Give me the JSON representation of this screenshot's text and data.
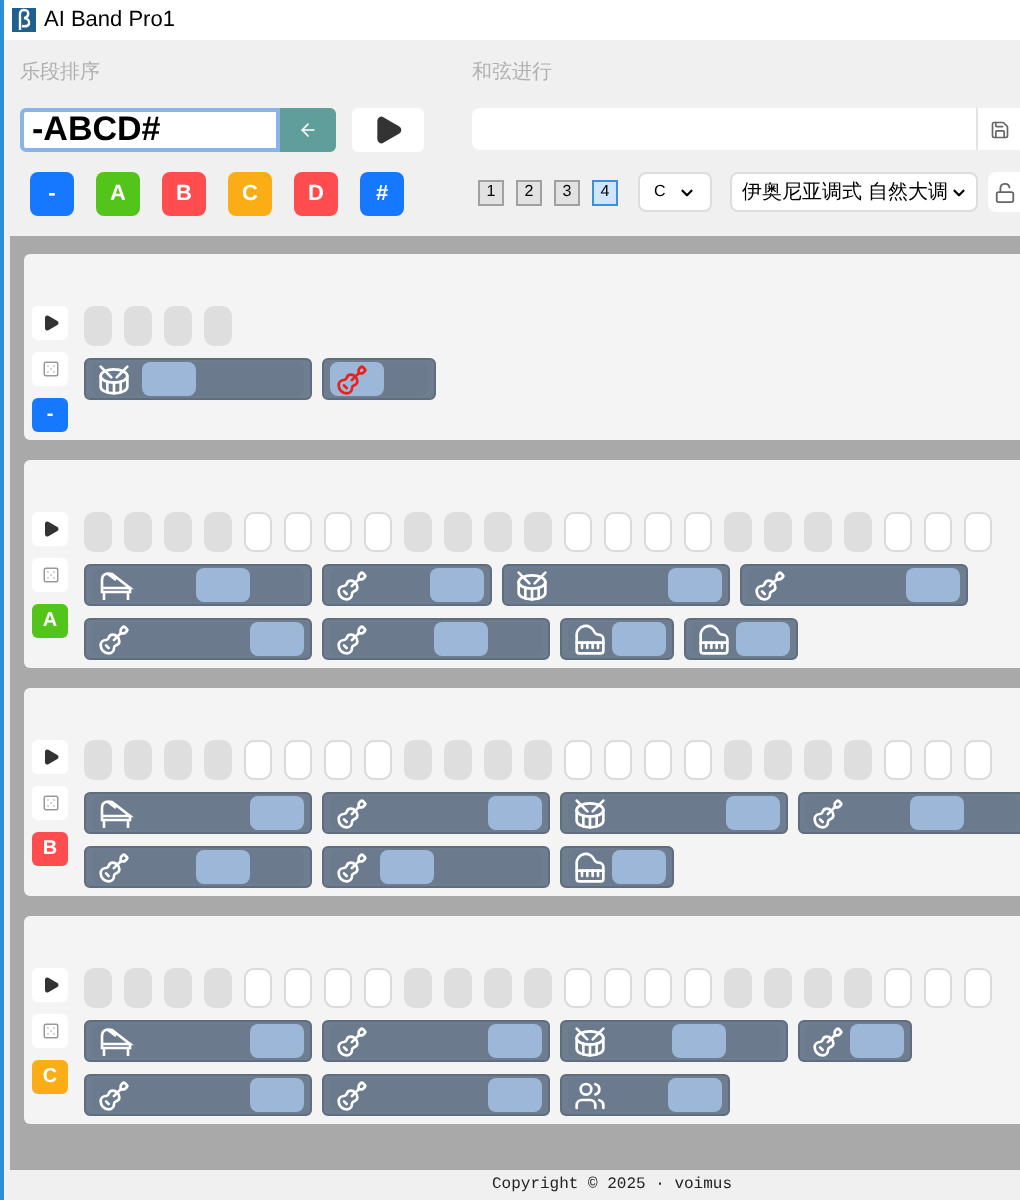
{
  "window": {
    "title": "AI Band Pro1"
  },
  "arrangement": {
    "label": "乐段排序",
    "value": "-ABCD#"
  },
  "progression": {
    "label": "和弦进行"
  },
  "section_buttons": [
    {
      "label": "-",
      "color": "#1677ff"
    },
    {
      "label": "A",
      "color": "#52c41a"
    },
    {
      "label": "B",
      "color": "#ff4d4f"
    },
    {
      "label": "C",
      "color": "#faad14"
    },
    {
      "label": "D",
      "color": "#ff4d4f"
    },
    {
      "label": "#",
      "color": "#1677ff"
    }
  ],
  "pages": [
    {
      "label": "1",
      "selected": false
    },
    {
      "label": "2",
      "selected": false
    },
    {
      "label": "3",
      "selected": false
    },
    {
      "label": "4",
      "selected": true
    }
  ],
  "key_select": {
    "value": "C"
  },
  "mode_select": {
    "value": "伊奥尼亚调式 自然大调"
  },
  "sections": [
    {
      "badge": "-",
      "color": "#1677ff",
      "beats": [
        true,
        true,
        true,
        true
      ],
      "rows": [
        [
          {
            "kind": "long",
            "icon": {
              "kind": "drum"
            },
            "selected": false,
            "level": 0.32
          },
          {
            "kind": "short",
            "icon": {
              "kind": "electric-guitar"
            },
            "selected": true,
            "level": 0
          }
        ]
      ]
    },
    {
      "badge": "A",
      "color": "#52c41a",
      "beats": [
        true,
        true,
        true,
        true,
        false,
        false,
        false,
        false,
        true,
        true,
        true,
        true,
        false,
        false,
        false,
        false,
        true,
        true,
        true,
        true,
        false,
        false,
        false
      ],
      "rows": [
        [
          {
            "kind": "long",
            "icon": {
              "kind": "piano"
            },
            "selected": false,
            "level": 0.66
          },
          {
            "kind": "medium",
            "icon": {
              "kind": "electric-guitar"
            },
            "selected": false,
            "level": 1
          },
          {
            "kind": "long",
            "icon": {
              "kind": "drum"
            },
            "selected": false,
            "level": 1
          },
          {
            "kind": "long",
            "icon": {
              "kind": "acoustic-guitar"
            },
            "selected": false,
            "level": 1
          }
        ],
        [
          {
            "kind": "long",
            "icon": {
              "kind": "electric-guitar"
            },
            "selected": false,
            "level": 1
          },
          {
            "kind": "long",
            "icon": {
              "kind": "bass"
            },
            "selected": false,
            "level": 0.66
          },
          {
            "kind": "short",
            "icon": {
              "kind": "keyboard"
            },
            "selected": false,
            "level": 1
          },
          {
            "kind": "short",
            "icon": {
              "kind": "keyboard"
            },
            "selected": false,
            "level": 1
          }
        ]
      ]
    },
    {
      "badge": "B",
      "color": "#ff4d4f",
      "beats": [
        true,
        true,
        true,
        true,
        false,
        false,
        false,
        false,
        true,
        true,
        true,
        true,
        false,
        false,
        false,
        false,
        true,
        true,
        true,
        true,
        false,
        false,
        false
      ],
      "rows": [
        [
          {
            "kind": "long",
            "icon": {
              "kind": "piano"
            },
            "selected": false,
            "level": 1
          },
          {
            "kind": "long",
            "icon": {
              "kind": "electric-guitar"
            },
            "selected": false,
            "level": 1
          },
          {
            "kind": "long",
            "icon": {
              "kind": "drum"
            },
            "selected": false,
            "level": 1
          },
          {
            "kind": "long",
            "icon": {
              "kind": "acoustic-guitar"
            },
            "selected": false,
            "level": 0.66
          }
        ],
        [
          {
            "kind": "long",
            "icon": {
              "kind": "electric-guitar"
            },
            "selected": false,
            "level": 0.66
          },
          {
            "kind": "long",
            "icon": {
              "kind": "bass"
            },
            "selected": false,
            "level": 0.32
          },
          {
            "kind": "short",
            "icon": {
              "kind": "keyboard"
            },
            "selected": false,
            "level": 1
          }
        ]
      ]
    },
    {
      "badge": "C",
      "color": "#faad14",
      "beats": [
        true,
        true,
        true,
        true,
        false,
        false,
        false,
        false,
        true,
        true,
        true,
        true,
        false,
        false,
        false,
        false,
        true,
        true,
        true,
        true,
        false,
        false,
        false
      ],
      "rows": [
        [
          {
            "kind": "long",
            "icon": {
              "kind": "piano"
            },
            "selected": false,
            "level": 1
          },
          {
            "kind": "long",
            "icon": {
              "kind": "electric-guitar"
            },
            "selected": false,
            "level": 1
          },
          {
            "kind": "long",
            "icon": {
              "kind": "drum"
            },
            "selected": false,
            "level": 0.66
          },
          {
            "kind": "short",
            "icon": {
              "kind": "acoustic-guitar"
            },
            "selected": false,
            "level": 1
          }
        ],
        [
          {
            "kind": "long",
            "icon": {
              "kind": "electric-guitar"
            },
            "selected": false,
            "level": 1
          },
          {
            "kind": "long",
            "icon": {
              "kind": "bass"
            },
            "selected": false,
            "level": 1
          },
          {
            "kind": "medium",
            "icon": {
              "kind": "choir"
            },
            "selected": false,
            "level": 1
          }
        ]
      ]
    }
  ],
  "footer": "Copyright © 2025 · voimus"
}
